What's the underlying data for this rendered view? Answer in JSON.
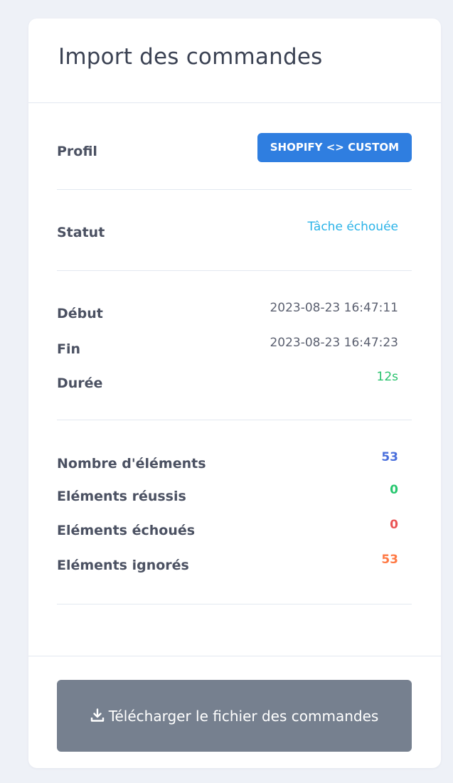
{
  "card": {
    "title": "Import des commandes"
  },
  "profile": {
    "label": "Profil",
    "value": "SHOPIFY <> CUSTOM"
  },
  "status": {
    "label": "Statut",
    "value": "Tâche échouée"
  },
  "timing": {
    "start_label": "Début",
    "start_value": "2023-08-23 16:47:11",
    "end_label": "Fin",
    "end_value": "2023-08-23 16:47:23",
    "duration_label": "Durée",
    "duration_value": "12s"
  },
  "elements": {
    "total_label": "Nombre d'éléments",
    "total_value": "53",
    "success_label": "Eléments réussis",
    "success_value": "0",
    "failed_label": "Eléments échoués",
    "failed_value": "0",
    "ignored_label": "Eléments ignorés",
    "ignored_value": "53"
  },
  "download": {
    "icon": "download-icon",
    "label": "Télécharger le fichier des commandes"
  },
  "colors": {
    "page_background": "#eef1f7",
    "card_background": "#ffffff",
    "badge_blue": "#2f7ee0",
    "status_info": "#2ab3e8",
    "duration_green": "#27c26c",
    "count_blue": "#4a6fdc",
    "success_green": "#28c76f",
    "failed_red": "#ea5455",
    "ignored_orange": "#ff7a45",
    "button_gray": "#76808f"
  }
}
